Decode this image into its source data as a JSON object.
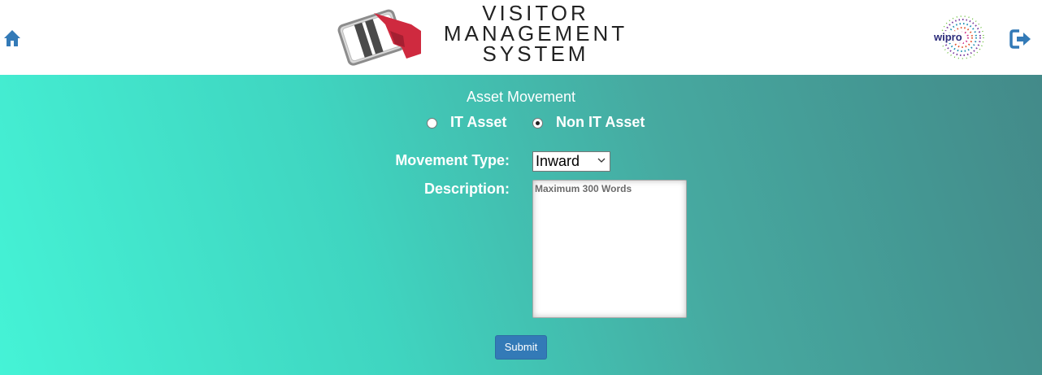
{
  "header": {
    "logo_lines": [
      "VISITOR",
      "MANAGEMENT",
      "SYSTEM"
    ],
    "partner_logo_text": "wipro"
  },
  "form": {
    "title": "Asset Movement",
    "radio_options": [
      {
        "label": "IT Asset",
        "checked": false
      },
      {
        "label": "Non IT Asset",
        "checked": true
      }
    ],
    "movement_type_label": "Movement Type:",
    "movement_type_value": "Inward",
    "description_label": "Description:",
    "description_placeholder": "Maximum 300 Words",
    "submit_label": "Submit"
  },
  "colors": {
    "accent": "#337ab7",
    "gradient_start": "#45f3d6",
    "gradient_end": "#438a89",
    "icon_blue": "#337ab7"
  },
  "icons": {
    "home": "home-icon",
    "logout": "logout-icon"
  }
}
